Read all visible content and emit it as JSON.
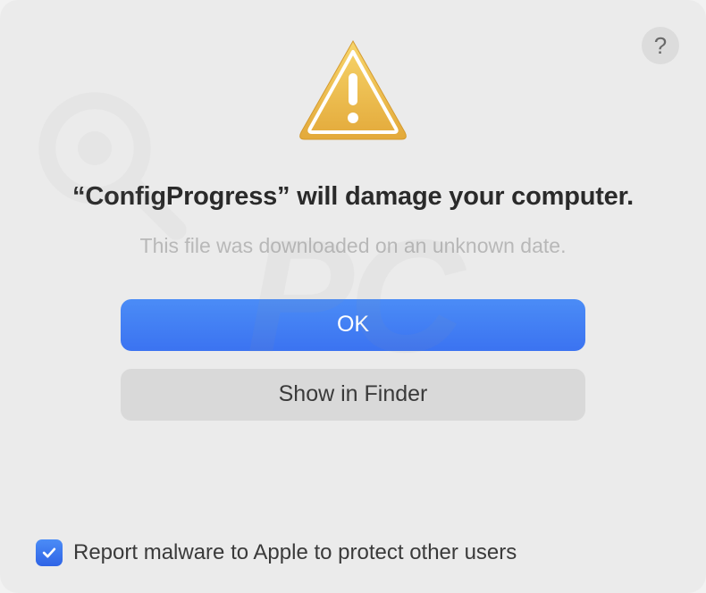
{
  "help": {
    "label": "?"
  },
  "title": "“ConfigProgress” will damage your computer.",
  "subtitle": "This file was downloaded on an unknown date.",
  "buttons": {
    "ok": "OK",
    "show_in_finder": "Show in Finder"
  },
  "checkbox": {
    "checked": true,
    "label": "Report malware to Apple to protect other users"
  },
  "watermark": "PC"
}
